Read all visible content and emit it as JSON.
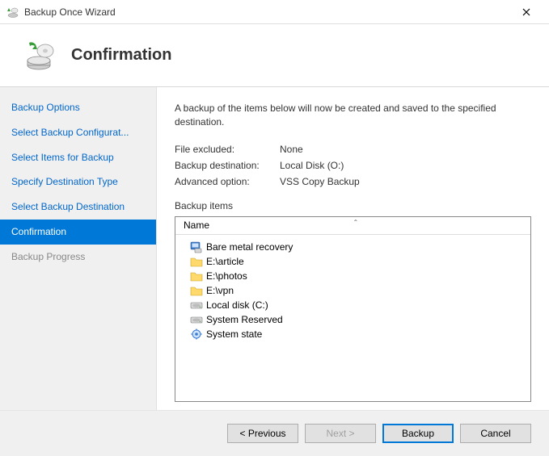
{
  "window": {
    "title": "Backup Once Wizard"
  },
  "header": {
    "title": "Confirmation"
  },
  "sidebar": {
    "items": [
      {
        "label": "Backup Options",
        "state": "normal"
      },
      {
        "label": "Select Backup Configurat...",
        "state": "normal"
      },
      {
        "label": "Select Items for Backup",
        "state": "normal"
      },
      {
        "label": "Specify Destination Type",
        "state": "normal"
      },
      {
        "label": "Select Backup Destination",
        "state": "normal"
      },
      {
        "label": "Confirmation",
        "state": "selected"
      },
      {
        "label": "Backup Progress",
        "state": "disabled"
      }
    ]
  },
  "content": {
    "description": "A backup of the items below will now be created and saved to the specified destination.",
    "info": [
      {
        "label": "File excluded:",
        "value": "None"
      },
      {
        "label": "Backup destination:",
        "value": "Local Disk (O:)"
      },
      {
        "label": "Advanced option:",
        "value": "VSS Copy Backup"
      }
    ],
    "backup_items_label": "Backup items",
    "list": {
      "header": "Name",
      "items": [
        {
          "icon": "bmr",
          "label": "Bare metal recovery"
        },
        {
          "icon": "folder",
          "label": "E:\\article"
        },
        {
          "icon": "folder",
          "label": "E:\\photos"
        },
        {
          "icon": "folder",
          "label": "E:\\vpn"
        },
        {
          "icon": "disk",
          "label": "Local disk (C:)"
        },
        {
          "icon": "disk",
          "label": "System Reserved"
        },
        {
          "icon": "system",
          "label": "System state"
        }
      ]
    }
  },
  "footer": {
    "previous": "< Previous",
    "next": "Next >",
    "backup": "Backup",
    "cancel": "Cancel"
  }
}
